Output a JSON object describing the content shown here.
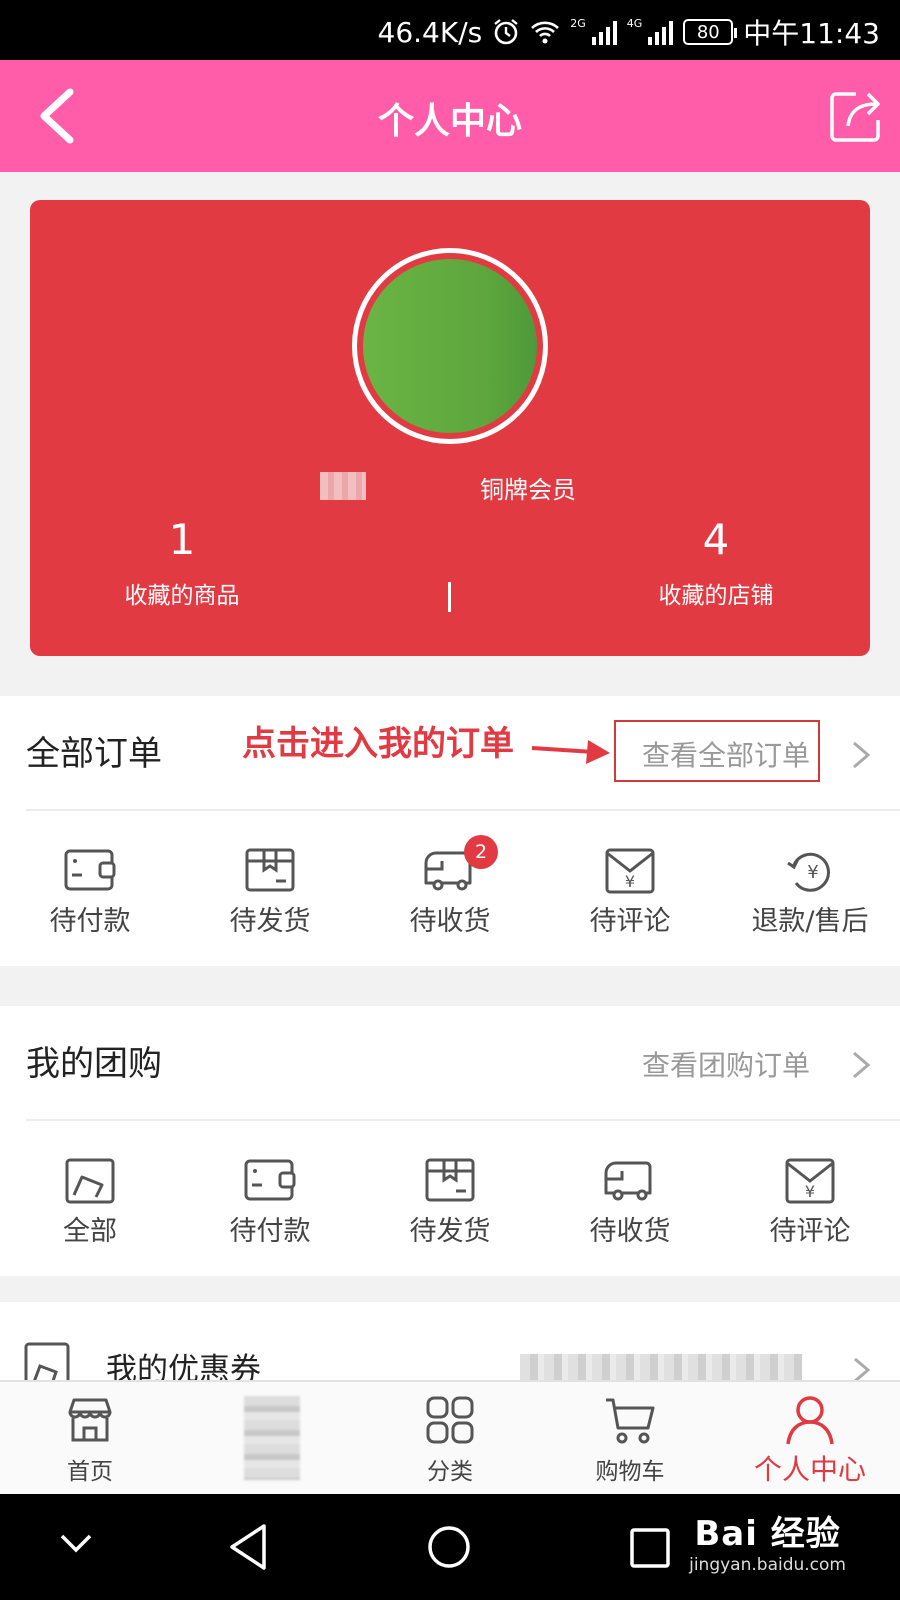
{
  "status_bar": {
    "net_speed": "46.4K/s",
    "net_2g": "2G",
    "net_4g": "4G",
    "battery": "80",
    "time": "中午11:43"
  },
  "header": {
    "title": "个人中心",
    "background": "#ff5caa"
  },
  "profile": {
    "member_level": "铜牌会员",
    "stats": [
      {
        "value": "1",
        "label": "收藏的商品"
      },
      {
        "value": "4",
        "label": "收藏的店铺"
      }
    ],
    "card_color": "#e23a42"
  },
  "orders": {
    "title": "全部订单",
    "link": "查看全部订单",
    "items": [
      {
        "label": "待付款",
        "icon": "wallet-icon"
      },
      {
        "label": "待发货",
        "icon": "package-icon"
      },
      {
        "label": "待收货",
        "icon": "truck-icon",
        "badge": "2"
      },
      {
        "label": "待评论",
        "icon": "yen-envelope-icon"
      },
      {
        "label": "退款/售后",
        "icon": "refund-icon"
      }
    ]
  },
  "annotation": {
    "text": "点击进入我的订单"
  },
  "group_buy": {
    "title": "我的团购",
    "link": "查看团购订单",
    "items": [
      {
        "label": "全部",
        "icon": "image-icon"
      },
      {
        "label": "待付款",
        "icon": "wallet-icon"
      },
      {
        "label": "待发货",
        "icon": "package-icon"
      },
      {
        "label": "待收货",
        "icon": "truck-icon"
      },
      {
        "label": "待评论",
        "icon": "yen-envelope-icon"
      }
    ]
  },
  "coupons": {
    "title": "我的优惠券"
  },
  "tabbar": {
    "active_color": "#e23a42",
    "tabs": [
      {
        "label": "首页",
        "icon": "shop-icon"
      },
      {
        "label": "",
        "icon": "blurred-icon"
      },
      {
        "label": "分类",
        "icon": "grid-icon"
      },
      {
        "label": "购物车",
        "icon": "cart-icon"
      },
      {
        "label": "个人中心",
        "icon": "user-icon"
      }
    ]
  },
  "watermark": {
    "main": "Bai 经验",
    "sub": "jingyan.baidu.com"
  }
}
